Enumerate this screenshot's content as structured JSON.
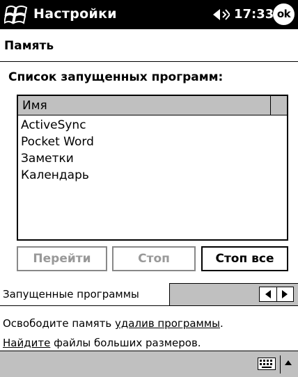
{
  "titlebar": {
    "title": "Настройки",
    "time": "17:33",
    "ok_label": "ok",
    "icons": [
      "windows-start-icon",
      "speaker-icon"
    ]
  },
  "page": {
    "subtitle": "Память",
    "section_label": "Список запущенных программ:"
  },
  "list": {
    "header": "Имя",
    "items": [
      "ActiveSync",
      "Pocket Word",
      "Заметки",
      "Календарь"
    ]
  },
  "buttons": {
    "go": "Перейти",
    "stop": "Стоп",
    "stop_all": "Стоп все"
  },
  "tabs": {
    "active": "Запущенные программы"
  },
  "help": {
    "line1_prefix": "Освободите память ",
    "line1_link": "удалив программы",
    "line1_suffix": ".",
    "line2_link": "Найдите",
    "line2_suffix": " файлы больших размеров."
  },
  "colors": {
    "titlebar_bg": "#000000",
    "bar_gray": "#c0c0c0",
    "disabled_text": "#999999"
  }
}
